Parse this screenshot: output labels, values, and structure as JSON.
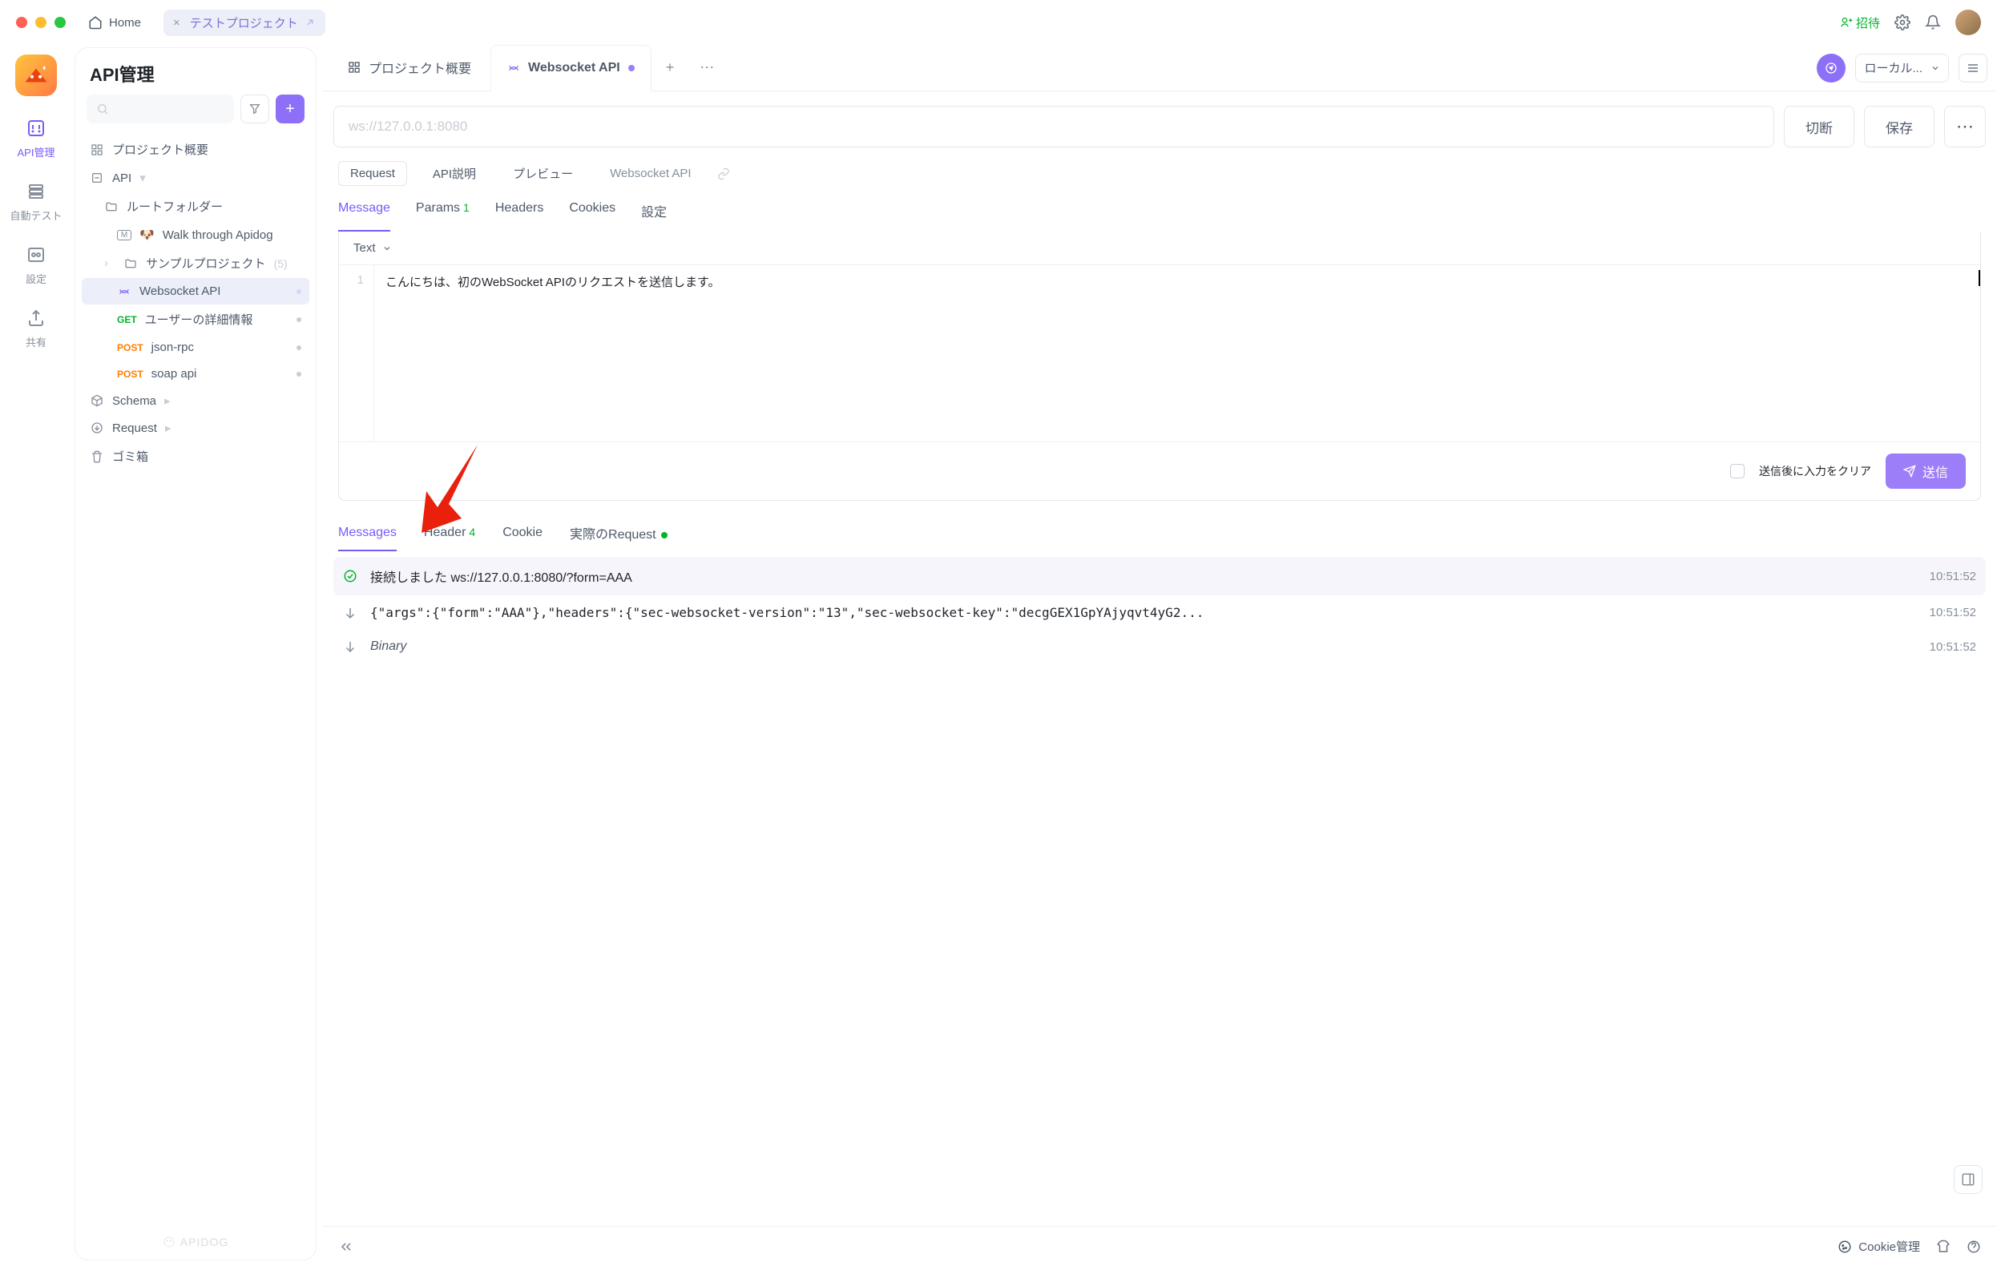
{
  "titlebar": {
    "home": "Home",
    "project_tab": "テストプロジェクト",
    "invite": "招待"
  },
  "leftrail": {
    "api": "API管理",
    "autotest": "自動テスト",
    "settings": "設定",
    "share": "共有"
  },
  "sidepanel": {
    "title": "API管理",
    "project_overview": "プロジェクト概要",
    "api_root": "API",
    "root_folder": "ルートフォルダー",
    "walk_through": "Walk through Apidog",
    "sample_project": "サンプルプロジェクト",
    "sample_count": "(5)",
    "websocket": "Websocket API",
    "user_detail": "ユーザーの詳細情報",
    "jsonrpc": "json-rpc",
    "soap": "soap api",
    "schema": "Schema",
    "request": "Request",
    "trash": "ゴミ箱",
    "brand": "APIDOG",
    "methods": {
      "get": "GET",
      "post": "POST"
    }
  },
  "tabs": {
    "overview": "プロジェクト概要",
    "websocket": "Websocket API",
    "env_label": "ローカル...",
    "env_run_tip": "run"
  },
  "urlbar": {
    "url": "ws://127.0.0.1:8080",
    "disconnect": "切断",
    "save": "保存"
  },
  "seg": {
    "request": "Request",
    "apidesc": "API説明",
    "preview": "プレビュー",
    "name": "Websocket API"
  },
  "subtabs": {
    "message": "Message",
    "params": "Params",
    "params_badge": "1",
    "headers": "Headers",
    "cookies": "Cookies",
    "settings": "設定"
  },
  "editor": {
    "format": "Text",
    "line1_num": "1",
    "line1_text": "こんにちは、初のWebSocket APIのリクエストを送信します。",
    "clear_label": "送信後に入力をクリア",
    "send": "送信"
  },
  "result_tabs": {
    "messages": "Messages",
    "header": "Header",
    "header_badge": "4",
    "cookie": "Cookie",
    "real_request": "実際のRequest"
  },
  "results": {
    "connected_label": "接続しました",
    "connected_url": "ws://127.0.0.1:8080/?form=AAA",
    "msg1": "{\"args\":{\"form\":\"AAA\"},\"headers\":{\"sec-websocket-version\":\"13\",\"sec-websocket-key\":\"decgGEX1GpYAjyqvt4yG2...",
    "binary": "Binary",
    "t1": "10:51:52",
    "t2": "10:51:52",
    "t3": "10:51:52"
  },
  "bottom": {
    "cookie_mgr": "Cookie管理"
  }
}
